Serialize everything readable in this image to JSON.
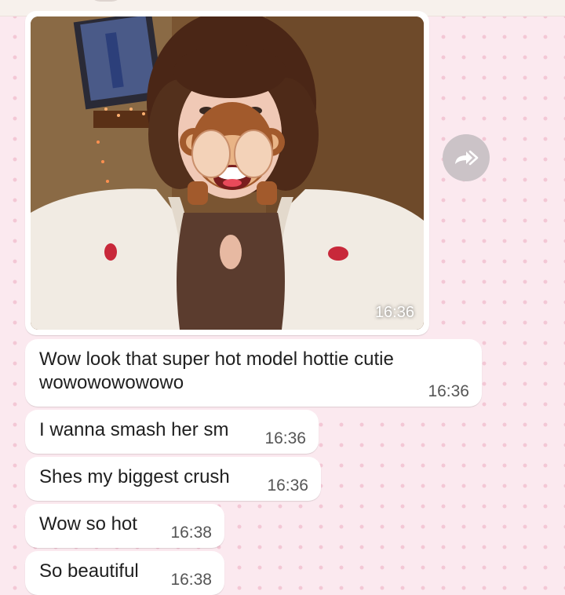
{
  "photo_message": {
    "time": "16:36",
    "emoji": "see-no-evil-monkey"
  },
  "forward": {
    "icon": "forward-icon"
  },
  "messages": [
    {
      "line1": "Wow look that super hot model hottie cutie",
      "line2": "wowowowowowo",
      "time": "16:36"
    },
    {
      "text": "I wanna smash her sm",
      "time": "16:36"
    },
    {
      "text": "Shes my biggest crush",
      "time": "16:36"
    },
    {
      "text": "Wow so hot",
      "time": "16:38"
    },
    {
      "text": "So beautiful",
      "time": "16:38"
    }
  ],
  "colors": {
    "chat_background": "#fbe9ef",
    "wallpaper_dots": "#f3c7d5",
    "bubble": "#ffffff",
    "forward_button": "#cbc3c7"
  }
}
